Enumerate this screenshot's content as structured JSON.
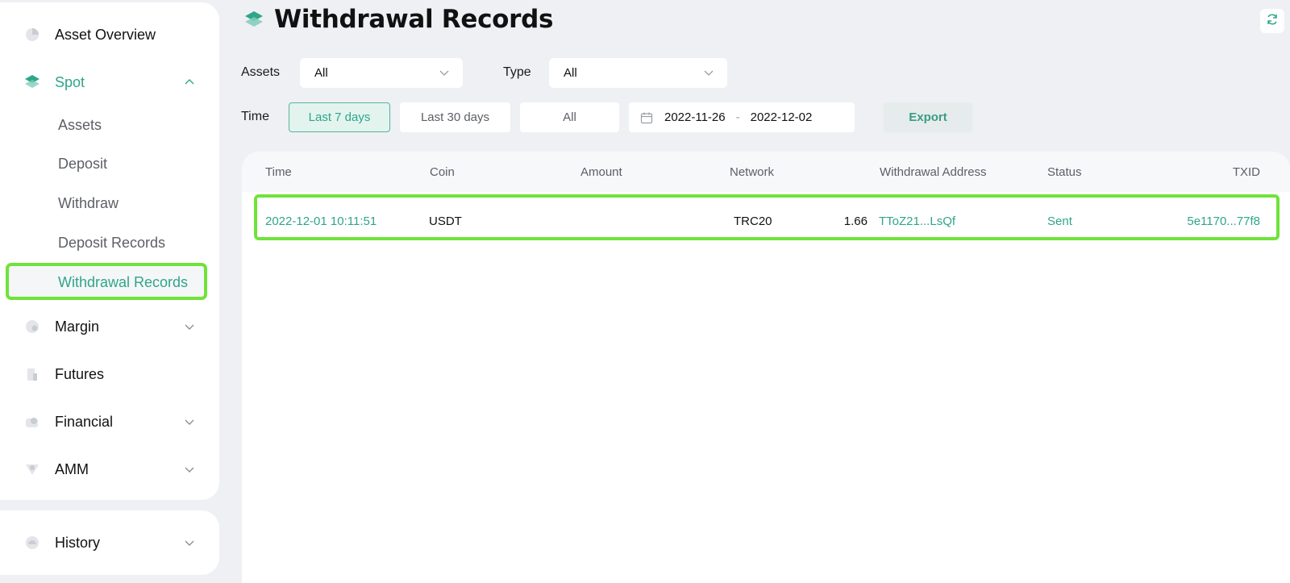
{
  "page": {
    "title": "Withdrawal Records"
  },
  "sidebar": {
    "asset_overview": "Asset Overview",
    "spot": "Spot",
    "spot_items": [
      "Assets",
      "Deposit",
      "Withdraw",
      "Deposit Records",
      "Withdrawal Records"
    ],
    "margin": "Margin",
    "futures": "Futures",
    "financial": "Financial",
    "amm": "AMM",
    "history": "History"
  },
  "filters": {
    "assets_label": "Assets",
    "assets_value": "All",
    "type_label": "Type",
    "type_value": "All",
    "time_label": "Time",
    "time_options": [
      "Last 7 days",
      "Last 30 days",
      "All"
    ],
    "time_selected": "Last 7 days",
    "date_start": "2022-11-26",
    "date_sep": "-",
    "date_end": "2022-12-02",
    "export_label": "Export"
  },
  "table": {
    "columns": [
      "Time",
      "Coin",
      "Amount",
      "Network",
      "Withdrawal Address",
      "Status",
      "TXID"
    ],
    "rows": [
      {
        "time": "2022-12-01 10:11:51",
        "coin": "USDT",
        "amount": "1.66",
        "network": "TRC20",
        "address": "TToZ21...LsQf",
        "status": "Sent",
        "txid": "5e1170...77f8"
      }
    ]
  },
  "colors": {
    "accent": "#2fa58a",
    "highlight": "#6fe33a",
    "background": "#eef0f4"
  }
}
